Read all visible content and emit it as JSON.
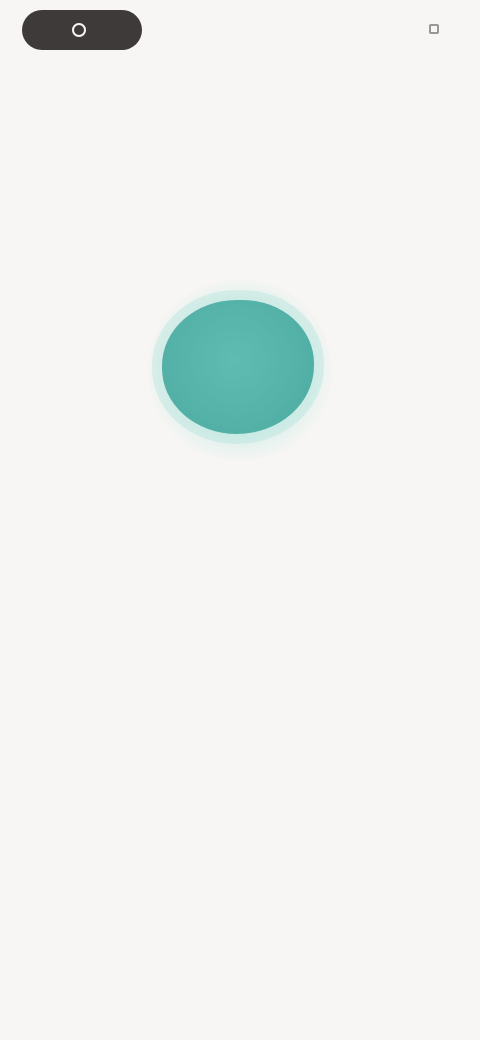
{
  "top_bar": {
    "pill_button_label": "",
    "top_right_label": ""
  },
  "center": {
    "title": "",
    "subtitle": ""
  },
  "bottom": {
    "hint": ""
  },
  "colors": {
    "background": "#f8f6f4",
    "accent_orb": "#54b2a8",
    "orb_glow": "#bceae4",
    "pill_dark": "#3f3a3a",
    "muted_text": "#b4afab"
  },
  "icons": {
    "pill_icon": "circle-icon",
    "top_right_icon": "square-icon"
  }
}
